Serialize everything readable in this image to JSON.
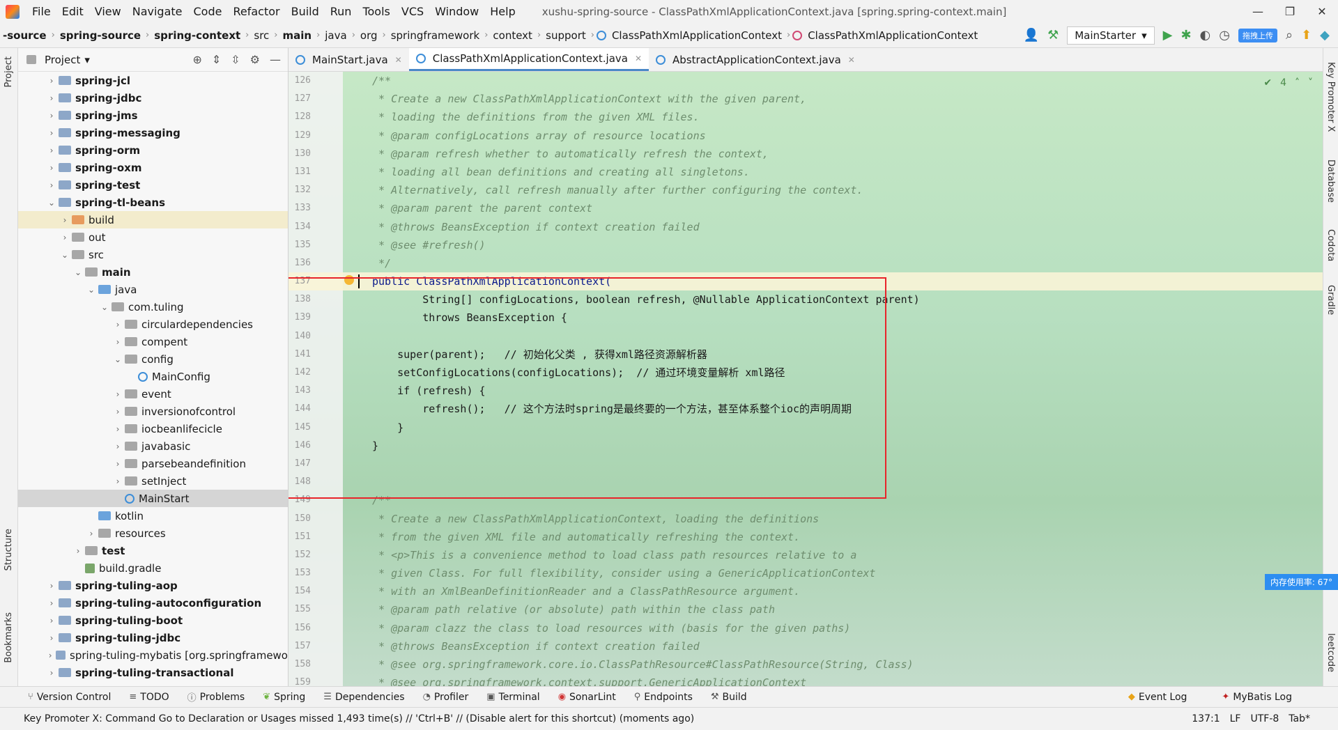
{
  "titlebar": {
    "menus": [
      "File",
      "Edit",
      "View",
      "Navigate",
      "Code",
      "Refactor",
      "Build",
      "Run",
      "Tools",
      "VCS",
      "Window",
      "Help"
    ],
    "title": "xushu-spring-source - ClassPathXmlApplicationContext.java [spring.spring-context.main]",
    "controls": [
      "—",
      "❐",
      "✕"
    ]
  },
  "breadcrumb": [
    "-source",
    "spring-source",
    "spring-context",
    "src",
    "main",
    "java",
    "org",
    "springframework",
    "context",
    "support",
    "ClassPathXmlApplicationContext",
    "ClassPathXmlApplicationContext"
  ],
  "navbar": {
    "run_config": "MainStarter",
    "upload_badge": "拖拽上传"
  },
  "left_strip": {
    "project": "Project",
    "structure": "Structure",
    "bookmarks": "Bookmarks"
  },
  "right_strip": {
    "key_promoter": "Key Promoter X",
    "database": "Database",
    "codota": "Codota",
    "gradle": "Gradle",
    "leetcode": "leetcode"
  },
  "project_panel": {
    "title": "Project",
    "tree": [
      {
        "label": "spring-jcl",
        "depth": 0,
        "arrow": "›",
        "icon": "mod",
        "bold": true
      },
      {
        "label": "spring-jdbc",
        "depth": 0,
        "arrow": "›",
        "icon": "mod",
        "bold": true
      },
      {
        "label": "spring-jms",
        "depth": 0,
        "arrow": "›",
        "icon": "mod",
        "bold": true
      },
      {
        "label": "spring-messaging",
        "depth": 0,
        "arrow": "›",
        "icon": "mod",
        "bold": true
      },
      {
        "label": "spring-orm",
        "depth": 0,
        "arrow": "›",
        "icon": "mod",
        "bold": true
      },
      {
        "label": "spring-oxm",
        "depth": 0,
        "arrow": "›",
        "icon": "mod",
        "bold": true
      },
      {
        "label": "spring-test",
        "depth": 0,
        "arrow": "›",
        "icon": "mod",
        "bold": true
      },
      {
        "label": "spring-tl-beans",
        "depth": 0,
        "arrow": "⌄",
        "icon": "mod",
        "bold": true
      },
      {
        "label": "build",
        "depth": 1,
        "arrow": "›",
        "icon": "orange",
        "bold": false,
        "hl": true
      },
      {
        "label": "out",
        "depth": 1,
        "arrow": "›",
        "icon": "plain",
        "bold": false
      },
      {
        "label": "src",
        "depth": 1,
        "arrow": "⌄",
        "icon": "plain",
        "bold": false
      },
      {
        "label": "main",
        "depth": 2,
        "arrow": "⌄",
        "icon": "plain",
        "bold": true
      },
      {
        "label": "java",
        "depth": 3,
        "arrow": "⌄",
        "icon": "blue",
        "bold": false
      },
      {
        "label": "com.tuling",
        "depth": 4,
        "arrow": "⌄",
        "icon": "plain",
        "bold": false
      },
      {
        "label": "circulardependencies",
        "depth": 5,
        "arrow": "›",
        "icon": "plain",
        "bold": false
      },
      {
        "label": "compent",
        "depth": 5,
        "arrow": "›",
        "icon": "plain",
        "bold": false
      },
      {
        "label": "config",
        "depth": 5,
        "arrow": "⌄",
        "icon": "plain",
        "bold": false
      },
      {
        "label": "MainConfig",
        "depth": 6,
        "arrow": "",
        "icon": "class",
        "bold": false
      },
      {
        "label": "event",
        "depth": 5,
        "arrow": "›",
        "icon": "plain",
        "bold": false
      },
      {
        "label": "inversionofcontrol",
        "depth": 5,
        "arrow": "›",
        "icon": "plain",
        "bold": false
      },
      {
        "label": "iocbeanlifecicle",
        "depth": 5,
        "arrow": "›",
        "icon": "plain",
        "bold": false
      },
      {
        "label": "javabasic",
        "depth": 5,
        "arrow": "›",
        "icon": "plain",
        "bold": false
      },
      {
        "label": "parsebeandefinition",
        "depth": 5,
        "arrow": "›",
        "icon": "plain",
        "bold": false
      },
      {
        "label": "setInject",
        "depth": 5,
        "arrow": "›",
        "icon": "plain",
        "bold": false
      },
      {
        "label": "MainStart",
        "depth": 5,
        "arrow": "",
        "icon": "class",
        "bold": false,
        "sel": true
      },
      {
        "label": "kotlin",
        "depth": 3,
        "arrow": "",
        "icon": "blue",
        "bold": false
      },
      {
        "label": "resources",
        "depth": 3,
        "arrow": "›",
        "icon": "plain",
        "bold": false
      },
      {
        "label": "test",
        "depth": 2,
        "arrow": "›",
        "icon": "plain",
        "bold": true
      },
      {
        "label": "build.gradle",
        "depth": 2,
        "arrow": "",
        "icon": "gradle",
        "bold": false
      },
      {
        "label": "spring-tuling-aop",
        "depth": 0,
        "arrow": "›",
        "icon": "mod",
        "bold": true
      },
      {
        "label": "spring-tuling-autoconfiguration",
        "depth": 0,
        "arrow": "›",
        "icon": "mod",
        "bold": true
      },
      {
        "label": "spring-tuling-boot",
        "depth": 0,
        "arrow": "›",
        "icon": "mod",
        "bold": true
      },
      {
        "label": "spring-tuling-jdbc",
        "depth": 0,
        "arrow": "›",
        "icon": "mod",
        "bold": true
      },
      {
        "label": "spring-tuling-mybatis [org.springframewo",
        "depth": 0,
        "arrow": "›",
        "icon": "mod",
        "bold": false
      },
      {
        "label": "spring-tuling-transactional",
        "depth": 0,
        "arrow": "›",
        "icon": "mod",
        "bold": true
      }
    ]
  },
  "tabs": [
    {
      "label": "MainStart.java",
      "active": false
    },
    {
      "label": "ClassPathXmlApplicationContext.java",
      "active": true
    },
    {
      "label": "AbstractApplicationContext.java",
      "active": false
    }
  ],
  "inspection": {
    "count": "4"
  },
  "code_lines": [
    {
      "n": "126",
      "t": "/**",
      "k": "doc"
    },
    {
      "n": "127",
      "t": " * Create a new ClassPathXmlApplicationContext with the given parent,",
      "k": "doc"
    },
    {
      "n": "128",
      "t": " * loading the definitions from the given XML files.",
      "k": "doc"
    },
    {
      "n": "129",
      "t": " * @param configLocations array of resource locations",
      "k": "doc"
    },
    {
      "n": "130",
      "t": " * @param refresh whether to automatically refresh the context,",
      "k": "doc"
    },
    {
      "n": "131",
      "t": " * loading all bean definitions and creating all singletons.",
      "k": "doc"
    },
    {
      "n": "132",
      "t": " * Alternatively, call refresh manually after further configuring the context.",
      "k": "doc"
    },
    {
      "n": "133",
      "t": " * @param parent the parent context",
      "k": "doc"
    },
    {
      "n": "134",
      "t": " * @throws BeansException if context creation failed",
      "k": "doc"
    },
    {
      "n": "135",
      "t": " * @see #refresh()",
      "k": "doc"
    },
    {
      "n": "136",
      "t": " */",
      "k": "doc"
    },
    {
      "n": "137",
      "t": "public ClassPathXmlApplicationContext(",
      "k": "kw",
      "cur": true
    },
    {
      "n": "138",
      "t": "        String[] configLocations, boolean refresh, @Nullable ApplicationContext parent)",
      "k": "code"
    },
    {
      "n": "139",
      "t": "        throws BeansException {",
      "k": "code"
    },
    {
      "n": "140",
      "t": "",
      "k": "code"
    },
    {
      "n": "141",
      "t": "    super(parent);   // 初始化父类 , 获得xml路径资源解析器",
      "k": "code"
    },
    {
      "n": "142",
      "t": "    setConfigLocations(configLocations);  // 通过环境变量解析 xml路径",
      "k": "code"
    },
    {
      "n": "143",
      "t": "    if (refresh) {",
      "k": "code"
    },
    {
      "n": "144",
      "t": "        refresh();   // 这个方法时spring是最终要的一个方法，甚至体系整个ioc的声明周期",
      "k": "code"
    },
    {
      "n": "145",
      "t": "    }",
      "k": "code"
    },
    {
      "n": "146",
      "t": "}",
      "k": "code"
    },
    {
      "n": "147",
      "t": "",
      "k": "code"
    },
    {
      "n": "148",
      "t": "",
      "k": "code"
    },
    {
      "n": "149",
      "t": "/**",
      "k": "doc"
    },
    {
      "n": "150",
      "t": " * Create a new ClassPathXmlApplicationContext, loading the definitions",
      "k": "doc"
    },
    {
      "n": "151",
      "t": " * from the given XML file and automatically refreshing the context.",
      "k": "doc"
    },
    {
      "n": "152",
      "t": " * <p>This is a convenience method to load class path resources relative to a",
      "k": "doc"
    },
    {
      "n": "153",
      "t": " * given Class. For full flexibility, consider using a GenericApplicationContext",
      "k": "doc"
    },
    {
      "n": "154",
      "t": " * with an XmlBeanDefinitionReader and a ClassPathResource argument.",
      "k": "doc"
    },
    {
      "n": "155",
      "t": " * @param path relative (or absolute) path within the class path",
      "k": "doc"
    },
    {
      "n": "156",
      "t": " * @param clazz the class to load resources with (basis for the given paths)",
      "k": "doc"
    },
    {
      "n": "157",
      "t": " * @throws BeansException if context creation failed",
      "k": "doc"
    },
    {
      "n": "158",
      "t": " * @see org.springframework.core.io.ClassPathResource#ClassPathResource(String, Class)",
      "k": "doc"
    },
    {
      "n": "159",
      "t": " * @see org.springframework.context.support.GenericApplicationContext",
      "k": "doc"
    }
  ],
  "memory_tip": "内存使用率: 67°",
  "toolwindows": {
    "left": [
      "Version Control",
      "TODO",
      "Problems",
      "Spring",
      "Dependencies",
      "Profiler",
      "Terminal",
      "SonarLint",
      "Endpoints",
      "Build"
    ],
    "right": [
      "Event Log",
      "MyBatis Log"
    ]
  },
  "status": {
    "message": "Key Promoter X: Command Go to Declaration or Usages missed 1,493 time(s) // 'Ctrl+B' // (Disable alert for this shortcut) (moments ago)",
    "position": "137:1",
    "line_sep": "LF",
    "encoding": "UTF-8",
    "indent": "Tab*"
  },
  "colors": {
    "accent": "#4a88c7",
    "highlight_box": "#e8242a",
    "code_bg": "#b7dfc0"
  }
}
